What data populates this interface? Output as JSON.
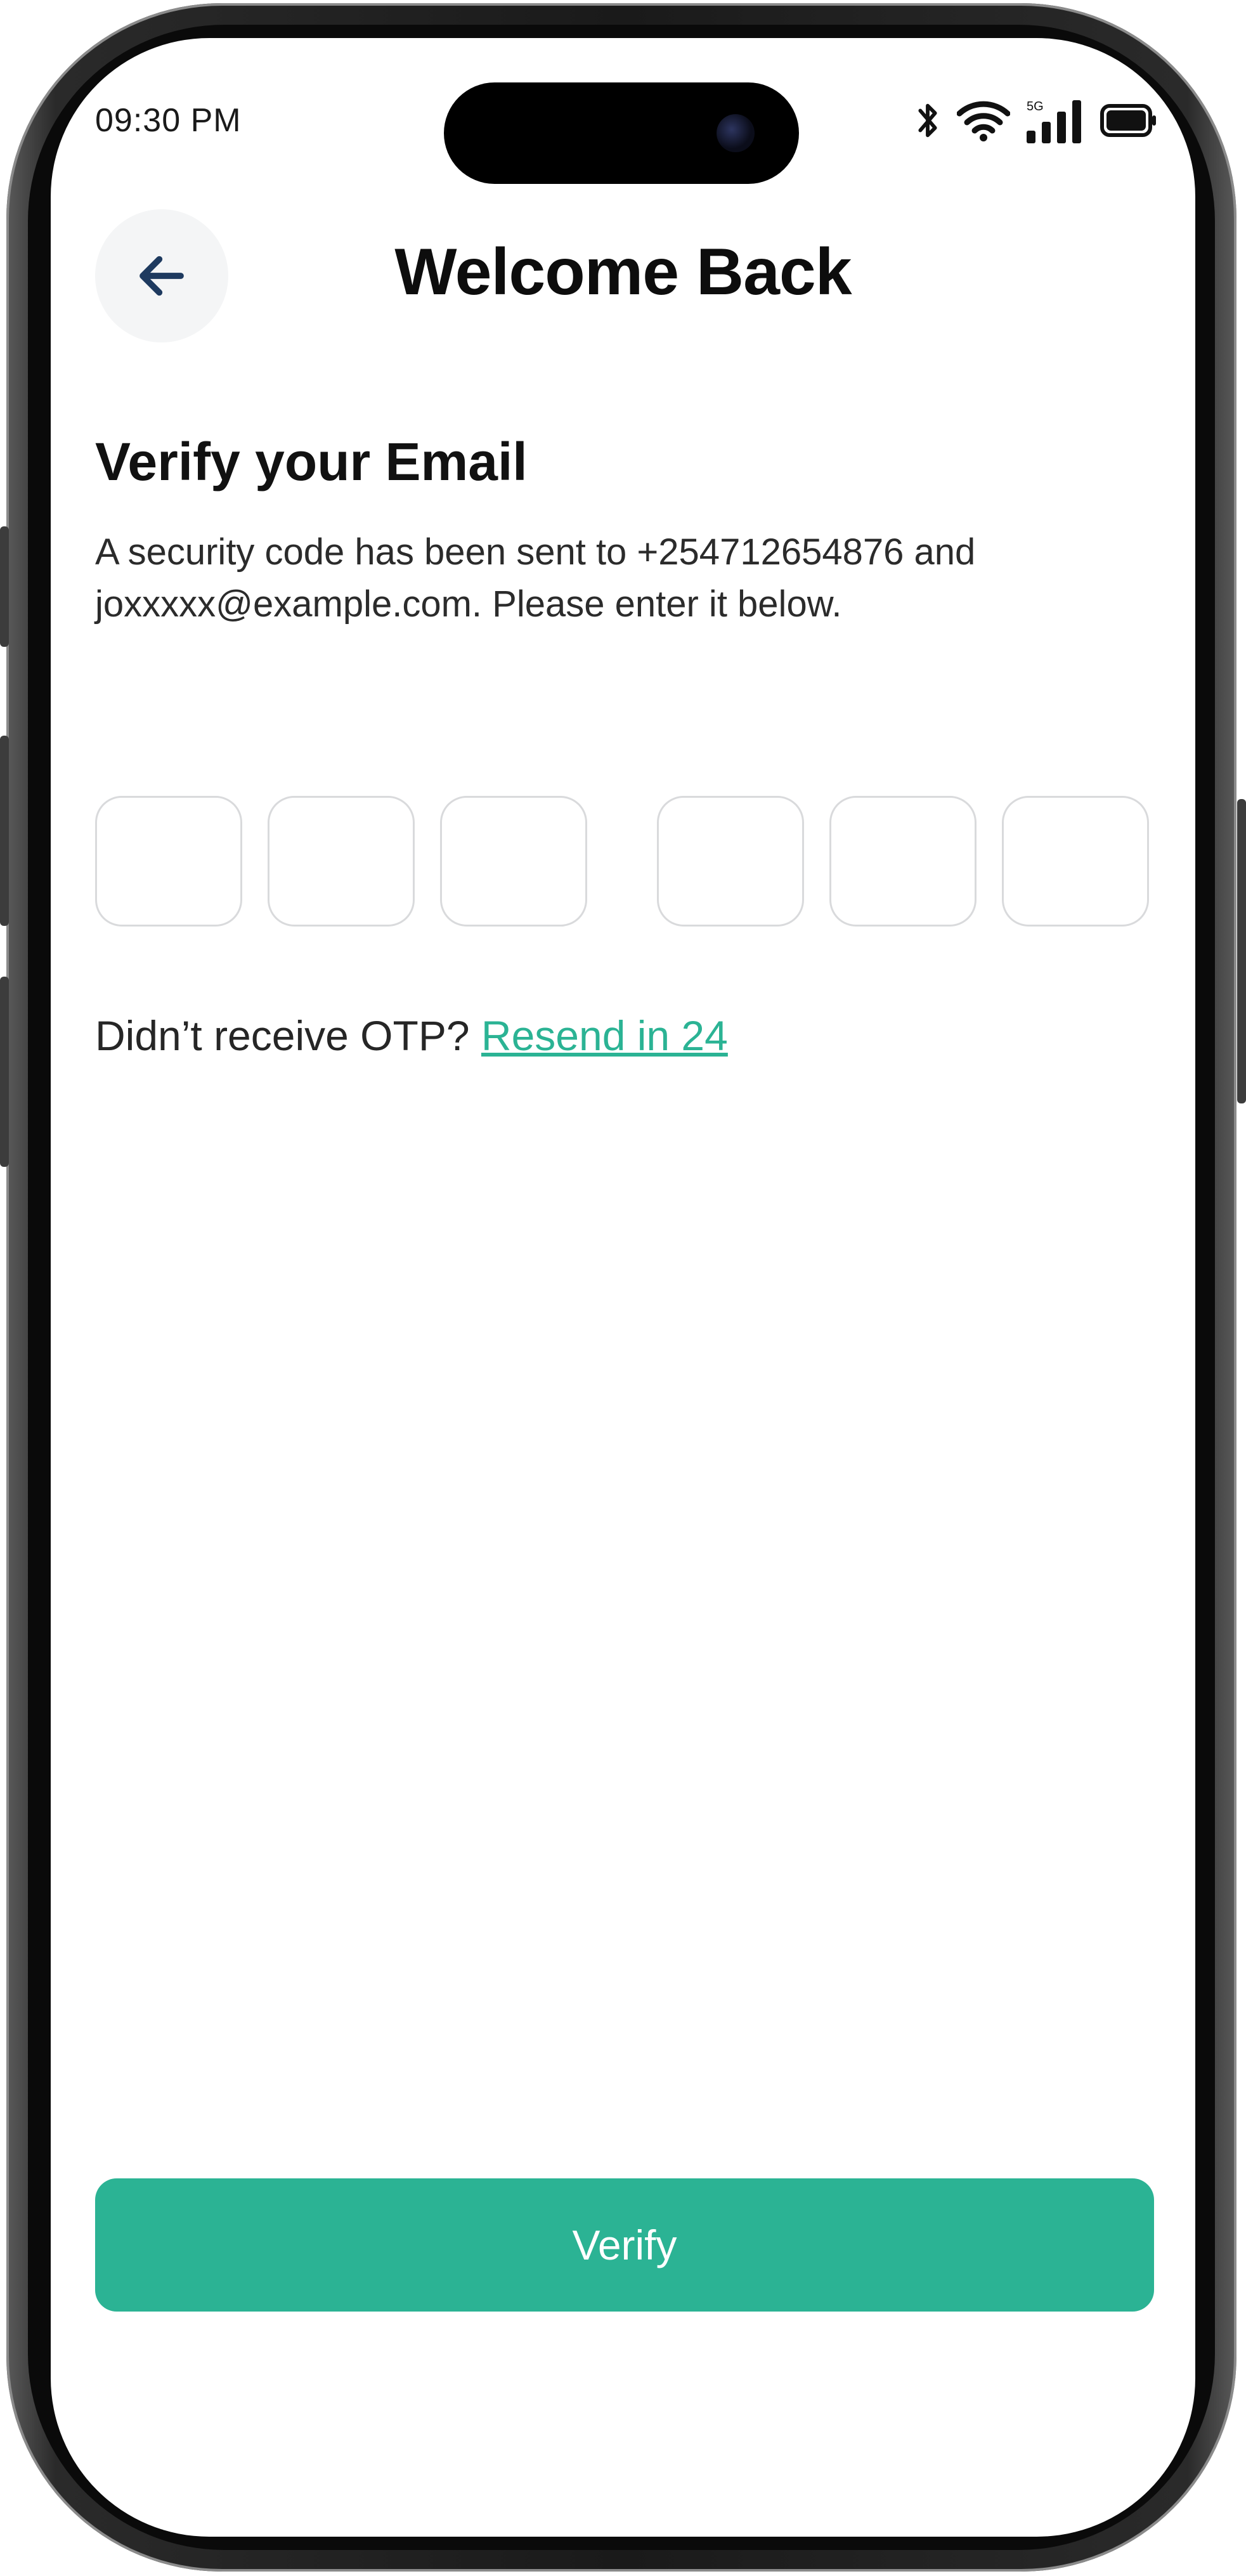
{
  "status_bar": {
    "time": "09:30 PM",
    "icons": [
      "bluetooth-icon",
      "wifi-icon",
      "cellular-5g-icon",
      "battery-icon"
    ],
    "network_label": "5G"
  },
  "header": {
    "back_icon": "arrow-left-icon",
    "title": "Welcome Back"
  },
  "content": {
    "heading": "Verify your Email",
    "description": "A security code has been sent to +254712654876 and joxxxxx@example.com. Please enter it below."
  },
  "otp": {
    "digits": [
      "",
      "",
      "",
      "",
      "",
      ""
    ]
  },
  "resend": {
    "prompt": "Didn’t receive OTP?",
    "link_label": "Resend in 24"
  },
  "actions": {
    "verify_label": "Verify"
  },
  "colors": {
    "accent": "#2bb394",
    "back_arrow": "#1e3a5f",
    "otp_border": "#d9dadc"
  }
}
